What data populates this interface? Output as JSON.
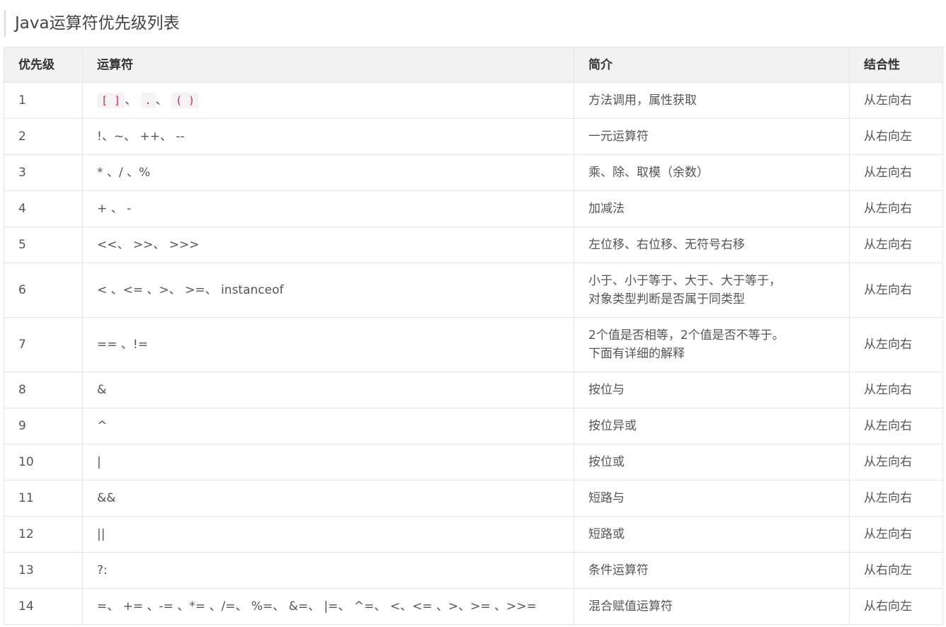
{
  "page": {
    "title": "Java运算符优先级列表"
  },
  "table": {
    "headers": {
      "level": "优先级",
      "operator": "运算符",
      "description": "简介",
      "associativity": "结合性"
    },
    "row1": {
      "level": "1",
      "op_code_1": "[ ]",
      "op_sep_1": "、",
      "op_code_2": ".",
      "op_sep_2": "、",
      "op_code_3": "( )",
      "description": "方法调用，属性获取",
      "associativity": "从左向右"
    },
    "rows": [
      {
        "level": "2",
        "operator": "!、~、 ++、 --",
        "description_1": "一元运算符",
        "description_2": "",
        "associativity": "从右向左"
      },
      {
        "level": "3",
        "operator": "* 、/ 、%",
        "description_1": "乘、除、取模（余数）",
        "description_2": "",
        "associativity": "从左向右"
      },
      {
        "level": "4",
        "operator": "+ 、 -",
        "description_1": "加减法",
        "description_2": "",
        "associativity": "从左向右"
      },
      {
        "level": "5",
        "operator": "<<、 >>、 >>>",
        "description_1": "左位移、右位移、无符号右移",
        "description_2": "",
        "associativity": "从左向右"
      },
      {
        "level": "6",
        "operator": "< 、<= 、>、 >=、 instanceof",
        "description_1": "小于、小于等于、大于、大于等于，",
        "description_2": "对象类型判断是否属于同类型",
        "associativity": "从左向右"
      },
      {
        "level": "7",
        "operator": "== 、!=",
        "description_1": "2个值是否相等，2个值是否不等于。",
        "description_2": "下面有详细的解释",
        "associativity": "从左向右"
      },
      {
        "level": "8",
        "operator": "&",
        "description_1": "按位与",
        "description_2": "",
        "associativity": "从左向右"
      },
      {
        "level": "9",
        "operator": "^",
        "description_1": "按位异或",
        "description_2": "",
        "associativity": "从左向右"
      },
      {
        "level": "10",
        "operator": "|",
        "description_1": "按位或",
        "description_2": "",
        "associativity": "从左向右"
      },
      {
        "level": "11",
        "operator": "&&",
        "description_1": "短路与",
        "description_2": "",
        "associativity": "从左向右"
      },
      {
        "level": "12",
        "operator": "||",
        "description_1": "短路或",
        "description_2": "",
        "associativity": "从左向右"
      },
      {
        "level": "13",
        "operator": "?:",
        "description_1": "条件运算符",
        "description_2": "",
        "associativity": "从右向左"
      },
      {
        "level": "14",
        "operator": "=、 += 、-= 、*= 、/=、 %=、 &=、 |=、 ^=、 <、<= 、>、>= 、>>=",
        "description_1": "混合赋值运算符",
        "description_2": "",
        "associativity": "从右向左"
      }
    ]
  }
}
